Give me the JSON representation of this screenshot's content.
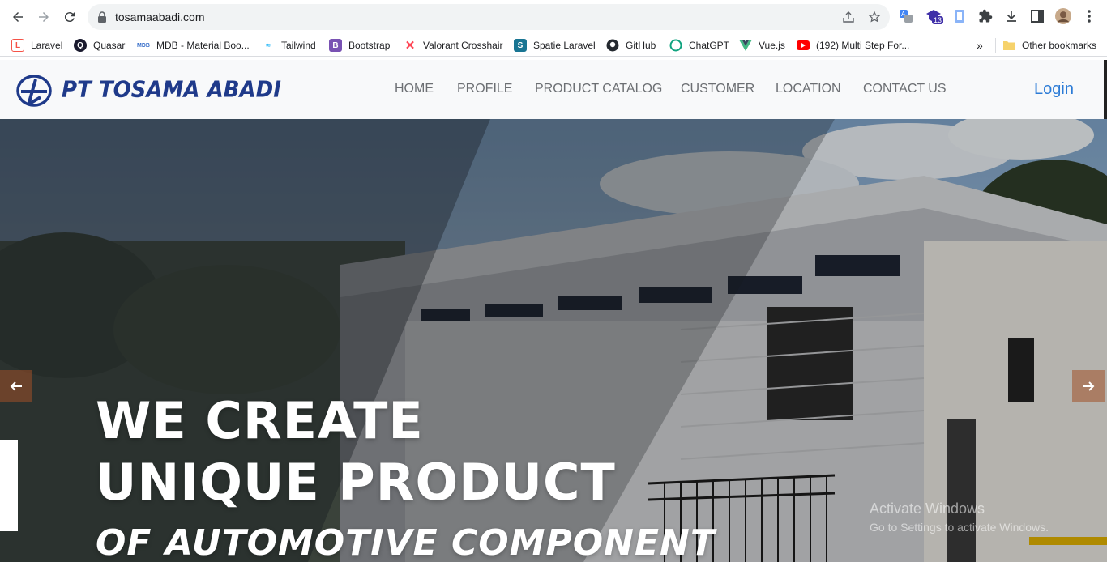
{
  "browser": {
    "url": "tosamaabadi.com",
    "bookmarks": [
      {
        "label": "Laravel",
        "icon": "laravel-icon",
        "color": "#f55247"
      },
      {
        "label": "Quasar",
        "icon": "quasar-icon",
        "color": "#1976d2"
      },
      {
        "label": "MDB - Material Boo...",
        "icon": "mdb-icon",
        "color": "#3b71ca"
      },
      {
        "label": "Tailwind",
        "icon": "tailwind-icon",
        "color": "#38bdf8"
      },
      {
        "label": "Bootstrap",
        "icon": "bootstrap-icon",
        "color": "#7952b3"
      },
      {
        "label": "Valorant Crosshair",
        "icon": "valorant-icon",
        "color": "#ff4655"
      },
      {
        "label": "Spatie Laravel",
        "icon": "spatie-icon",
        "color": "#197593"
      },
      {
        "label": "GitHub",
        "icon": "github-icon",
        "color": "#24292f"
      },
      {
        "label": "ChatGPT",
        "icon": "chatgpt-icon",
        "color": "#10a37f"
      },
      {
        "label": "Vue.js",
        "icon": "vue-icon",
        "color": "#42b883"
      },
      {
        "label": "(192) Multi Step For...",
        "icon": "youtube-icon",
        "color": "#ff0000"
      }
    ],
    "more_label": "»",
    "other_bookmarks": "Other bookmarks",
    "extension_badge": "13"
  },
  "site": {
    "brand": "PT TOSAMA ABADI",
    "menu": [
      "HOME",
      "PROFILE",
      "PRODUCT CATALOG",
      "CUSTOMER",
      "LOCATION",
      "CONTACT US"
    ],
    "login": "Login"
  },
  "hero": {
    "line1": "WE CREATE",
    "line2": "UNIQUE PRODUCT",
    "line3": "OF AUTOMOTIVE COMPONENT"
  },
  "os_watermark": {
    "title": "Activate Windows",
    "subtitle": "Go to Settings to activate Windows."
  },
  "colors": {
    "brand_blue": "#1f3a8a",
    "login_blue": "#2b7bd6",
    "arrow_bg": "#a05028"
  }
}
